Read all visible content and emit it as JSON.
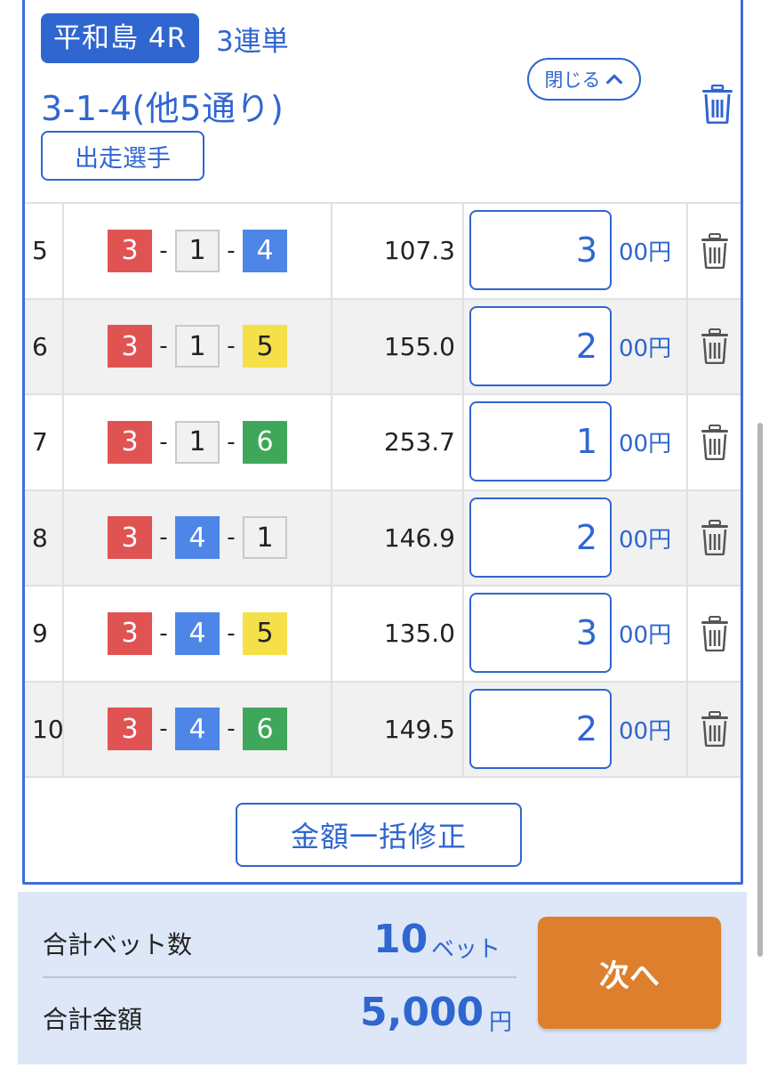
{
  "header": {
    "venue": "平和島 4R",
    "bet_type": "3連単",
    "combo_title": "3-1-4(他5通り)",
    "close_label": "閉じる",
    "runners_label": "出走選手"
  },
  "rows": [
    {
      "no": "5",
      "combo": [
        "3",
        "1",
        "4"
      ],
      "odds": "107.3",
      "amount": "3",
      "unit": "00円"
    },
    {
      "no": "6",
      "combo": [
        "3",
        "1",
        "5"
      ],
      "odds": "155.0",
      "amount": "2",
      "unit": "00円"
    },
    {
      "no": "7",
      "combo": [
        "3",
        "1",
        "6"
      ],
      "odds": "253.7",
      "amount": "1",
      "unit": "00円"
    },
    {
      "no": "8",
      "combo": [
        "3",
        "4",
        "1"
      ],
      "odds": "146.9",
      "amount": "2",
      "unit": "00円"
    },
    {
      "no": "9",
      "combo": [
        "3",
        "4",
        "5"
      ],
      "odds": "135.0",
      "amount": "3",
      "unit": "00円"
    },
    {
      "no": "10",
      "combo": [
        "3",
        "4",
        "6"
      ],
      "odds": "149.5",
      "amount": "2",
      "unit": "00円"
    }
  ],
  "dash": "-",
  "bulk_edit_label": "金額一括修正",
  "footer": {
    "total_bets_label": "合計ベット数",
    "total_bets_value": "10",
    "total_bets_unit": "ベット",
    "total_amount_label": "合計金額",
    "total_amount_value": "5,000",
    "total_amount_unit": "円",
    "next_label": "次へ"
  },
  "colors": {
    "accent": "#2f66d0",
    "boat_1": "#f1f1f1",
    "boat_3": "#e05353",
    "boat_4": "#4d86e6",
    "boat_5": "#f5e04a",
    "boat_6": "#3fa75a",
    "next_button": "#dd7f2c",
    "footer_bg": "#dde7f7"
  },
  "icons": {
    "delete": "trash-icon",
    "close": "chevron-up-icon"
  }
}
